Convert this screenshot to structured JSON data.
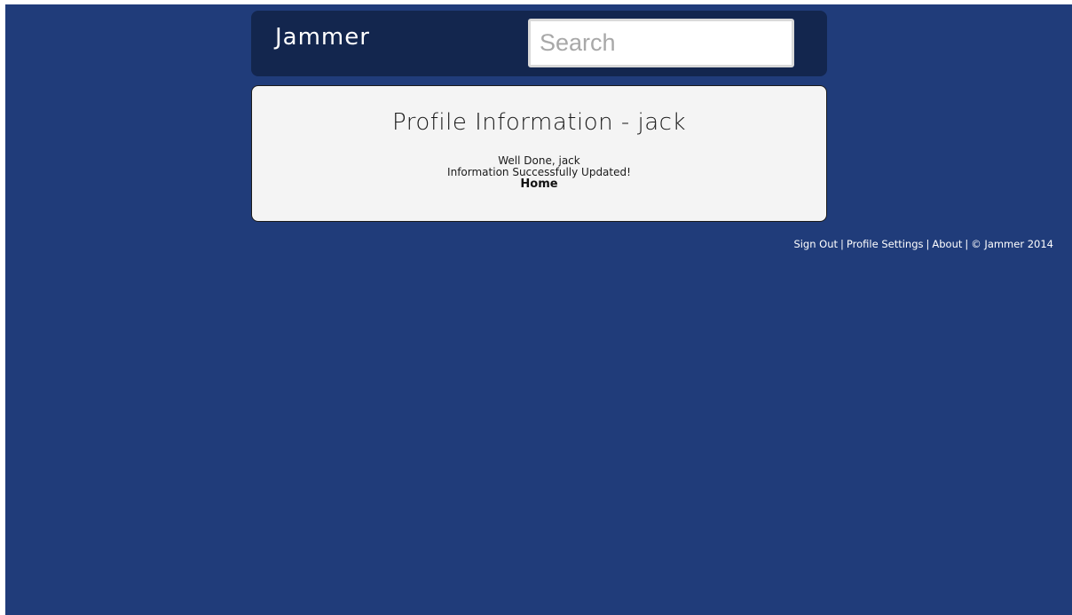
{
  "header": {
    "app_title": "Jammer",
    "search": {
      "placeholder": "Search",
      "value": ""
    }
  },
  "profile": {
    "title": "Profile Information - jack",
    "greeting": "Well Done, jack",
    "status": "Information Successfully Updated!",
    "home_link": "Home"
  },
  "footer": {
    "sign_out": "Sign Out",
    "separator": "|",
    "profile_settings": "Profile Settings",
    "about": "About",
    "copyright": "© Jammer 2014"
  },
  "colors": {
    "page_background": "#203c7a",
    "header_background": "#13264e",
    "card_background": "#f4f4f4"
  }
}
